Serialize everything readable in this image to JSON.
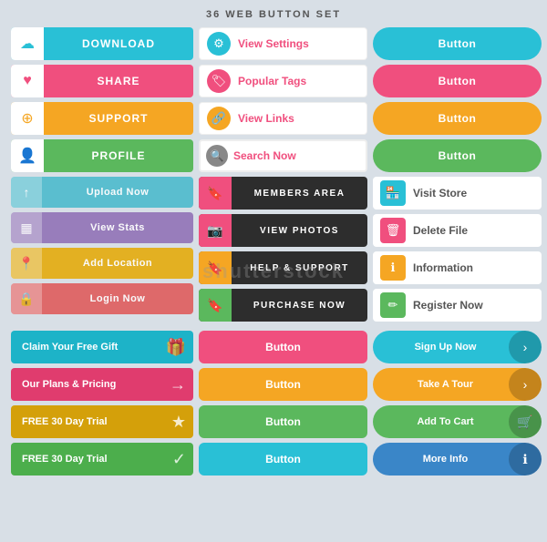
{
  "title": "36 WEB BUTTON SET",
  "col1_row1": [
    {
      "label": "DOWNLOAD",
      "icon": "☁",
      "color": "btn-blue"
    },
    {
      "label": "SHARE",
      "icon": "♥",
      "color": "btn-pink"
    },
    {
      "label": "SUPPORT",
      "icon": "⊕",
      "color": "btn-orange"
    },
    {
      "label": "PROFILE",
      "icon": "👤",
      "color": "btn-green-dark"
    }
  ],
  "col1_row2": [
    {
      "label": "Upload Now",
      "icon": "↑",
      "color": "btn-teal"
    },
    {
      "label": "View Stats",
      "icon": "▦",
      "color": "btn-purple"
    },
    {
      "label": "Add Location",
      "icon": "📍",
      "color": "btn-yellow"
    },
    {
      "label": "Login Now",
      "icon": "🔒",
      "color": "btn-red"
    }
  ],
  "col2_row1": [
    {
      "label": "View Settings",
      "icon": "⚙",
      "ic": "ic-blue"
    },
    {
      "label": "Popular Tags",
      "icon": "🏷",
      "ic": "ic-pink"
    },
    {
      "label": "View Links",
      "icon": "🔗",
      "ic": "ic-orange"
    },
    {
      "label": "Search Now",
      "icon": "🔍",
      "ic": "ic-gray"
    }
  ],
  "col2_row2": [
    {
      "label": "MEMBERS AREA",
      "icon": "🔖",
      "ic": "pink"
    },
    {
      "label": "VIEW PHOTOS",
      "icon": "📷",
      "ic": "pink"
    },
    {
      "label": "HELP & SUPPORT",
      "icon": "🔖",
      "ic": "orange"
    },
    {
      "label": "PURCHASE NOW",
      "icon": "🔖",
      "ic": "green"
    }
  ],
  "col3_row1": [
    {
      "label": "Button",
      "color": "pill-blue"
    },
    {
      "label": "Button",
      "color": "pill-pink"
    },
    {
      "label": "Button",
      "color": "pill-orange"
    },
    {
      "label": "Button",
      "color": "pill-green"
    }
  ],
  "col3_row2": [
    {
      "label": "Visit Store",
      "icon": "🏪",
      "ic_color": "#29c0d6"
    },
    {
      "label": "Delete File",
      "icon": "🗑",
      "ic_color": "#f04f7e"
    },
    {
      "label": "Information",
      "icon": "ℹ",
      "ic_color": "#f5a623"
    },
    {
      "label": "Register Now",
      "icon": "✏",
      "ic_color": "#5bb85d"
    }
  ],
  "col1_bottom": [
    {
      "label": "Claim Your Free Gift",
      "icon": "🎁",
      "color": "claim-teal"
    },
    {
      "label": "Our Plans & Pricing",
      "icon": "→",
      "color": "claim-red"
    },
    {
      "label": "FREE 30 Day Trial",
      "icon": "★",
      "color": "claim-yellow"
    },
    {
      "label": "FREE 30 Day Trial",
      "icon": "✓",
      "color": "claim-yellow2"
    }
  ],
  "col2_bottom": [
    {
      "label": "Button",
      "color": "#f04f7e"
    },
    {
      "label": "Button",
      "color": "#f5a623"
    },
    {
      "label": "Button",
      "color": "#5bb85d"
    },
    {
      "label": "Button",
      "color": "#29c0d6"
    }
  ],
  "col3_bottom": [
    {
      "label": "Sign Up Now",
      "icon": "›",
      "color": "pa-teal"
    },
    {
      "label": "Take A Tour",
      "icon": "›",
      "color": "pa-orange"
    },
    {
      "label": "Add To Cart",
      "icon": "🛒",
      "color": "pa-green"
    },
    {
      "label": "More Info",
      "icon": "ℹ",
      "color": "pa-blue"
    }
  ]
}
